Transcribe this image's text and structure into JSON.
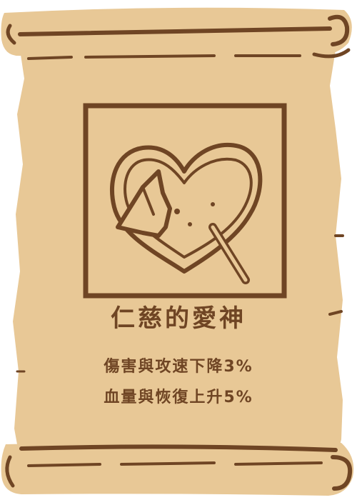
{
  "card": {
    "title": "仁慈的愛神",
    "effects": [
      "傷害與攻速下降3%",
      "血量與恢復上升5%"
    ],
    "icon": "broken-heart-arrow-icon"
  },
  "colors": {
    "parchment": "#e8c896",
    "ink": "#6f4524"
  }
}
